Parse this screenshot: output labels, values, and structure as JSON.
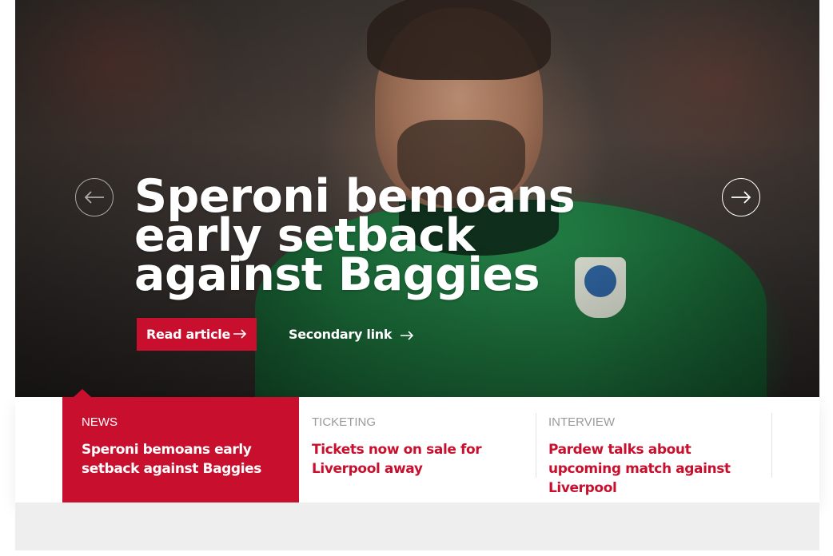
{
  "hero": {
    "title": "Speroni bemoans early setback against Baggies",
    "primary_cta": "Read article",
    "secondary_cta": "Secondary link"
  },
  "icons": {
    "prev": "arrow-left-circle-icon",
    "next": "arrow-right-circle-icon",
    "cta_arrow": "arrow-right-icon"
  },
  "colors": {
    "accent": "#c8102e",
    "muted_text": "#9a9a9a"
  },
  "cards": [
    {
      "category": "NEWS",
      "headline": "Speroni bemoans early setback against Baggies",
      "active": true
    },
    {
      "category": "TICKETING",
      "headline": "Tickets now on sale for Liverpool away",
      "active": false
    },
    {
      "category": "INTERVIEW",
      "headline": "Pardew talks about upcoming match against Liverpool",
      "active": false
    }
  ]
}
